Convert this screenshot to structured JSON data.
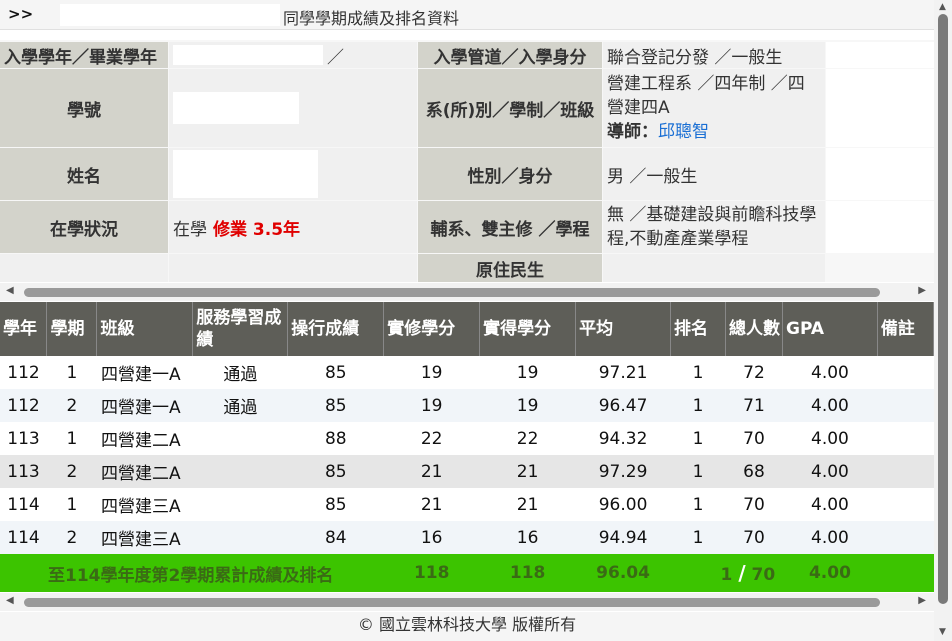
{
  "header": {
    "nav": ">>",
    "title": "同學學期成績及排名資料"
  },
  "info": {
    "enroll_year_label": "入學學年／畢業學年",
    "enroll_year_value": "／",
    "admission_label": "入學管道／入學身分",
    "admission_value": "聯合登記分發 ／一般生",
    "student_id_label": "學號",
    "dept_label": "系(所)別／學制／班級",
    "dept_value": "營建工程系 ／四年制 ／四營建四A",
    "advisor_label": "導師：",
    "advisor_name": "邱聰智",
    "name_label": "姓名",
    "gender_label": "性別／身分",
    "gender_value": "男 ／一般生",
    "status_label": "在學狀況",
    "status_value": "在學",
    "status_extra": "修業 3.5年",
    "minor_label": "輔系、雙主修 ／學程",
    "minor_value": "無 ／基礎建設與前瞻科技學程,不動產產業學程",
    "aboriginal_label": "原住民生"
  },
  "table": {
    "headers": [
      "學年",
      "學期",
      "班級",
      "服務學習成績",
      "操行成績",
      "實修學分",
      "實得學分",
      "平均",
      "排名",
      "總人數",
      "GPA",
      "備註"
    ],
    "rows": [
      [
        "112",
        "1",
        "四營建一A",
        "通過",
        "85",
        "19",
        "19",
        "97.21",
        "1",
        "72",
        "4.00",
        ""
      ],
      [
        "112",
        "2",
        "四營建一A",
        "通過",
        "85",
        "19",
        "19",
        "96.47",
        "1",
        "71",
        "4.00",
        ""
      ],
      [
        "113",
        "1",
        "四營建二A",
        "",
        "88",
        "22",
        "22",
        "94.32",
        "1",
        "70",
        "4.00",
        ""
      ],
      [
        "113",
        "2",
        "四營建二A",
        "",
        "85",
        "21",
        "21",
        "97.29",
        "1",
        "68",
        "4.00",
        ""
      ],
      [
        "114",
        "1",
        "四營建三A",
        "",
        "85",
        "21",
        "21",
        "96.00",
        "1",
        "70",
        "4.00",
        ""
      ],
      [
        "114",
        "2",
        "四營建三A",
        "",
        "84",
        "16",
        "16",
        "94.94",
        "1",
        "70",
        "4.00",
        ""
      ]
    ],
    "total": {
      "label": "至114學年度第2學期累計成績及排名",
      "attempted": "118",
      "earned": "118",
      "average": "96.04",
      "rank": "1",
      "sep": "/",
      "count": "70",
      "gpa": "4.00"
    }
  },
  "footer": {
    "copyright": "© 國立雲林科技大學 版權所有"
  }
}
